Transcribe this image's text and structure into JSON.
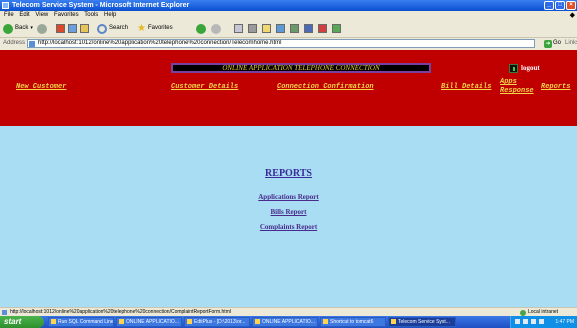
{
  "window": {
    "title": "Telecom Service System - Microsoft Internet Explorer",
    "controls": {
      "minimize": "_",
      "maximize": "□",
      "close": "×"
    }
  },
  "menubar": {
    "items": [
      "File",
      "Edit",
      "View",
      "Favorites",
      "Tools",
      "Help"
    ]
  },
  "toolbar": {
    "back_label": "Back",
    "search_label": "Search",
    "favorites_label": "Favorites"
  },
  "addressbar": {
    "label": "Address",
    "url": "http://localhost:1012/online%20application%20telephone%20connection/Telecomhome.html",
    "go_label": "Go",
    "links_label": "Links"
  },
  "page": {
    "banner": "ONLINE APPLICATION TELEPHONE CONNECTION",
    "logout_label": "logout",
    "nav": {
      "new_customer": "New Customer",
      "customer_details": "Customer Details",
      "connection_confirmation": "Connection Confirmation",
      "bill_details": "Bill Details",
      "apps_response_line1": "Apps",
      "apps_response_line2": "Response",
      "reports": "Reports"
    },
    "reports": {
      "title": "REPORTS",
      "applications_report": "Applications Report",
      "bills_report": "Bills Report",
      "complaints_report": "Complaints Report"
    }
  },
  "statusbar": {
    "text": "http://localhost:1012/online%20application%20telephone%20connection/ComplaintReportForm.html",
    "zone": "Local intranet"
  },
  "taskbar": {
    "start_label": "start",
    "buttons": [
      "Run SQL Command Line",
      "ONLINE APPLICATIO...",
      "EditPlus - [D:\\2013\\or...",
      "ONLINE APPLICATIO...",
      "Shortcut to tomcat6",
      "Telecom Service Syst..."
    ],
    "clock": "1:47 PM"
  },
  "colors": {
    "header_bg": "#c00000",
    "content_bg": "#a8ddf4",
    "nav_link": "#f2d64a",
    "banner_text": "#e9d22a",
    "report_link": "#4a2a8a"
  }
}
